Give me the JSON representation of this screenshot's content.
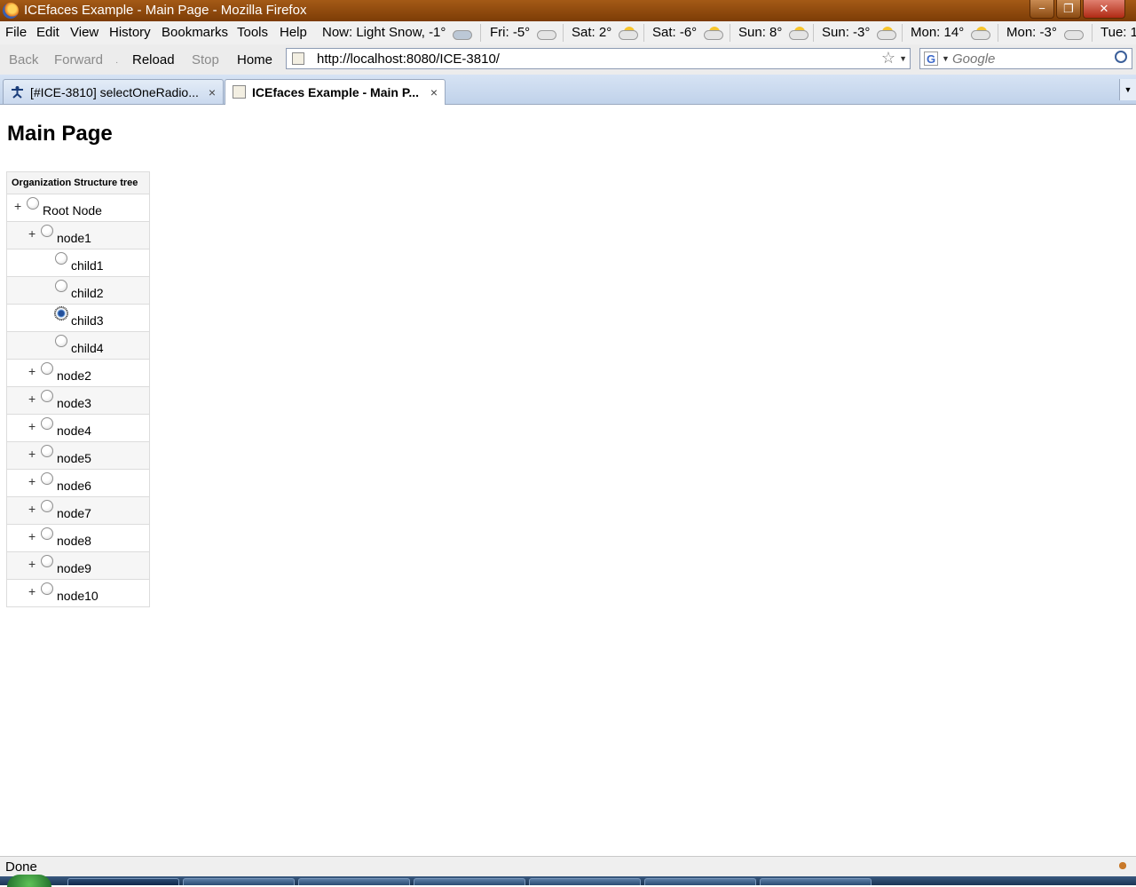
{
  "window": {
    "title": "ICEfaces Example - Main Page - Mozilla Firefox",
    "controls": {
      "minimize": "−",
      "restore": "❐",
      "close": "✕"
    }
  },
  "menubar": {
    "items": [
      "File",
      "Edit",
      "View",
      "History",
      "Bookmarks",
      "Tools",
      "Help"
    ],
    "weather": [
      {
        "label": "Now: Light Snow, -1°",
        "icon": "snow-cloud-icon"
      },
      {
        "label": "Fri: -5°",
        "icon": "cloud-icon"
      },
      {
        "label": "Sat: 2°",
        "icon": "sun-cloud-icon"
      },
      {
        "label": "Sat: -6°",
        "icon": "sun-cloud-icon"
      },
      {
        "label": "Sun: 8°",
        "icon": "sun-cloud-icon"
      },
      {
        "label": "Sun: -3°",
        "icon": "sun-cloud-icon"
      },
      {
        "label": "Mon: 14°",
        "icon": "sun-cloud-icon"
      },
      {
        "label": "Mon: -3°",
        "icon": "cloud-icon"
      },
      {
        "label": "Tue: 1",
        "icon": ""
      }
    ]
  },
  "navbar": {
    "back": "Back",
    "forward": "Forward",
    "reload": "Reload",
    "stop": "Stop",
    "home": "Home",
    "url": "http://localhost:8080/ICE-3810/",
    "search_placeholder": "Google"
  },
  "tabs": [
    {
      "label": "[#ICE-3810] selectOneRadio...",
      "active": false,
      "close": "×"
    },
    {
      "label": "ICEfaces Example - Main P...",
      "active": true,
      "close": "×"
    }
  ],
  "page": {
    "heading": "Main Page",
    "tree": {
      "header": "Organization Structure tree",
      "nodes": [
        {
          "label": "Root Node",
          "level": 0,
          "expandable": true,
          "selected": false
        },
        {
          "label": "node1",
          "level": 1,
          "expandable": true,
          "selected": false
        },
        {
          "label": "child1",
          "level": 2,
          "expandable": false,
          "selected": false
        },
        {
          "label": "child2",
          "level": 2,
          "expandable": false,
          "selected": false
        },
        {
          "label": "child3",
          "level": 2,
          "expandable": false,
          "selected": true
        },
        {
          "label": "child4",
          "level": 2,
          "expandable": false,
          "selected": false
        },
        {
          "label": "node2",
          "level": 1,
          "expandable": true,
          "selected": false
        },
        {
          "label": "node3",
          "level": 1,
          "expandable": true,
          "selected": false
        },
        {
          "label": "node4",
          "level": 1,
          "expandable": true,
          "selected": false
        },
        {
          "label": "node5",
          "level": 1,
          "expandable": true,
          "selected": false
        },
        {
          "label": "node6",
          "level": 1,
          "expandable": true,
          "selected": false
        },
        {
          "label": "node7",
          "level": 1,
          "expandable": true,
          "selected": false
        },
        {
          "label": "node8",
          "level": 1,
          "expandable": true,
          "selected": false
        },
        {
          "label": "node9",
          "level": 1,
          "expandable": true,
          "selected": false
        },
        {
          "label": "node10",
          "level": 1,
          "expandable": true,
          "selected": false
        }
      ],
      "expander_symbol": "+"
    }
  },
  "status": {
    "text": "Done"
  }
}
